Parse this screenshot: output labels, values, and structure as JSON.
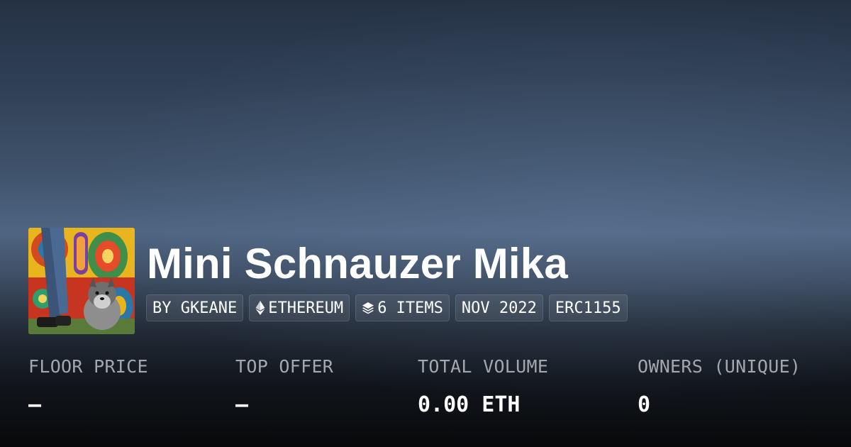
{
  "collection": {
    "name": "Mini Schnauzer Mika",
    "avatar_alt": "Mini Schnauzer Mika avatar"
  },
  "tags": [
    {
      "label": "BY GKEANE",
      "icon": null
    },
    {
      "label": "ETHEREUM",
      "icon": "ethereum-icon"
    },
    {
      "label": "6 ITEMS",
      "icon": "layers-icon"
    },
    {
      "label": "NOV 2022",
      "icon": null
    },
    {
      "label": "ERC1155",
      "icon": null
    }
  ],
  "stats": [
    {
      "label": "FLOOR PRICE",
      "value": "—"
    },
    {
      "label": "TOP OFFER",
      "value": "—"
    },
    {
      "label": "TOTAL VOLUME",
      "value": "0.00 ETH"
    },
    {
      "label": "OWNERS (UNIQUE)",
      "value": "0"
    }
  ],
  "colors": {
    "background_top": "#253244",
    "background_mid": "#4f6582",
    "background_bottom": "#08090b",
    "text_primary": "#ffffff",
    "text_muted": "#a4a8ae"
  }
}
